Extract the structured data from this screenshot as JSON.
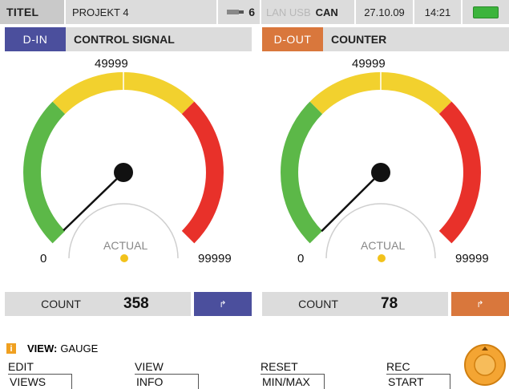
{
  "topbar": {
    "title": "TITEL",
    "project": "PROJEKT 4",
    "usb_count": "6",
    "lan_usb": "LAN USB",
    "can": "CAN",
    "date": "27.10.09",
    "time": "14:21",
    "battery_color": "#3cb43c"
  },
  "panels": [
    {
      "type": "D-IN",
      "type_color": "#4b4f9d",
      "name": "CONTROL SIGNAL",
      "min": "0",
      "mid": "49999",
      "max": "99999",
      "actual_label": "ACTUAL",
      "value": 358,
      "count_label": "COUNT",
      "count_value": "358",
      "button_color": "#4b4f9d",
      "button_icon": "arrow-icon",
      "arrow_glyph": "↱"
    },
    {
      "type": "D-OUT",
      "type_color": "#d9773c",
      "name": "COUNTER",
      "min": "0",
      "mid": "49999",
      "max": "99999",
      "actual_label": "ACTUAL",
      "value": 78,
      "count_label": "COUNT",
      "count_value": "78",
      "button_color": "#d9773c",
      "button_icon": "arrow-icon",
      "arrow_glyph": "↱"
    }
  ],
  "gauge_colors": {
    "green": "#5cb848",
    "yellow": "#f2d12e",
    "red": "#e8312a"
  },
  "footer": {
    "info_icon": "i",
    "view_label": "VIEW:",
    "view_value": "GAUGE",
    "softkeys": [
      {
        "line1": "EDIT",
        "line2": "VIEWS"
      },
      {
        "line1": "VIEW",
        "line2": "INFO"
      },
      {
        "line1": "RESET",
        "line2": "MIN/MAX"
      },
      {
        "line1": "REC",
        "line2": "START"
      }
    ],
    "nav_color": "#f4a533"
  }
}
